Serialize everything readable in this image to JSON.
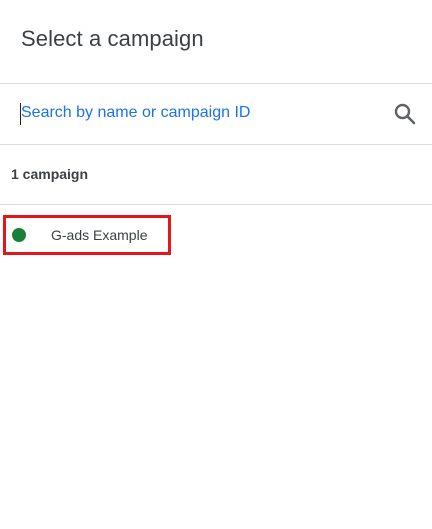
{
  "dialog": {
    "title": "Select a campaign"
  },
  "search": {
    "placeholder": "Search by name or campaign ID",
    "value": "",
    "icon": "search-icon"
  },
  "results": {
    "count_label": "1 campaign"
  },
  "campaigns": [
    {
      "name": "G-ads Example",
      "status_color": "#188038",
      "highlighted": true,
      "highlight_color": "#e3161b"
    }
  ],
  "colors": {
    "accent": "#1a73e8",
    "status_active": "#188038",
    "highlight": "#e3161b",
    "divider": "#dadce0"
  }
}
